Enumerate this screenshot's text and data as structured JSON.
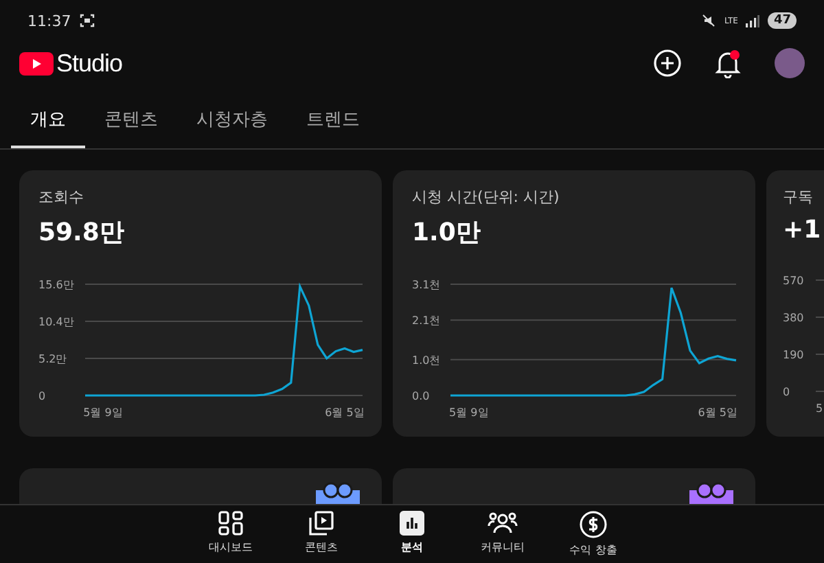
{
  "status_bar": {
    "time": "11:37",
    "battery": "47",
    "network": "LTE"
  },
  "header": {
    "logo_text": "Studio"
  },
  "tabs": [
    {
      "label": "개요",
      "selected": true
    },
    {
      "label": "콘텐츠",
      "selected": false
    },
    {
      "label": "시청자층",
      "selected": false
    },
    {
      "label": "트렌드",
      "selected": false
    }
  ],
  "metric_cards": [
    {
      "title": "조회수",
      "value": "59.8만",
      "chart_data": {
        "type": "line",
        "categories": [
          null,
          null,
          "5월 9일",
          null,
          null,
          null,
          null,
          null,
          null,
          null,
          null,
          null,
          null,
          null,
          null,
          null,
          null,
          null,
          null,
          null,
          null,
          null,
          null,
          null,
          null,
          null,
          null,
          null,
          null,
          "6월 5일",
          null,
          null
        ],
        "series": [
          {
            "color": "#0ea5d4",
            "values": [
              0,
              0,
              0,
              0,
              0,
              0,
              0,
              0,
              0,
              0,
              0,
              0,
              0,
              0,
              0,
              0,
              0,
              0,
              0,
              0,
              0.1,
              0.4,
              0.9,
              1.8,
              15.3,
              12.6,
              7.1,
              5.2,
              6.2,
              6.6,
              6.1,
              6.4
            ]
          }
        ],
        "ylim": [
          0,
          15.6
        ],
        "yticks": [
          {
            "value": 15.6,
            "label": "15.6만"
          },
          {
            "value": 10.4,
            "label": "10.4만"
          },
          {
            "value": 5.2,
            "label": "5.2만"
          },
          {
            "value": 0,
            "label": "0"
          }
        ]
      }
    },
    {
      "title": "시청 시간(단위: 시간)",
      "value": "1.0만",
      "chart_data": {
        "type": "line",
        "categories": [
          null,
          null,
          "5월 9일",
          null,
          null,
          null,
          null,
          null,
          null,
          null,
          null,
          null,
          null,
          null,
          null,
          null,
          null,
          null,
          null,
          null,
          null,
          null,
          null,
          null,
          null,
          null,
          null,
          null,
          null,
          "6월 5일",
          null,
          null
        ],
        "series": [
          {
            "color": "#0ea5d4",
            "values": [
              0,
              0,
              0,
              0,
              0,
              0,
              0,
              0,
              0,
              0,
              0,
              0,
              0,
              0,
              0,
              0,
              0,
              0,
              0,
              0,
              0.03,
              0.1,
              0.29,
              0.45,
              3.0,
              2.3,
              1.25,
              0.9,
              1.03,
              1.1,
              1.02,
              0.98
            ]
          }
        ],
        "ylim": [
          0,
          3.1
        ],
        "yticks": [
          {
            "value": 3.1,
            "label": "3.1천"
          },
          {
            "value": 2.1,
            "label": "2.1천"
          },
          {
            "value": 1.0,
            "label": "1.0천"
          },
          {
            "value": 0,
            "label": "0.0"
          }
        ]
      }
    }
  ],
  "partial_card": {
    "title": "구독",
    "value": "+1",
    "y_labels": [
      "570",
      "380",
      "190",
      "0"
    ],
    "x_label": "5"
  },
  "promo_cards": [
    {
      "color": "#6c9bff"
    },
    {
      "color": "#a970ff"
    }
  ],
  "bottom_nav": [
    {
      "label": "대시보드",
      "selected": false
    },
    {
      "label": "콘텐츠",
      "selected": false
    },
    {
      "label": "분석",
      "selected": true
    },
    {
      "label": "커뮤니티",
      "selected": false
    },
    {
      "label": "수익 창출",
      "selected": false
    }
  ]
}
